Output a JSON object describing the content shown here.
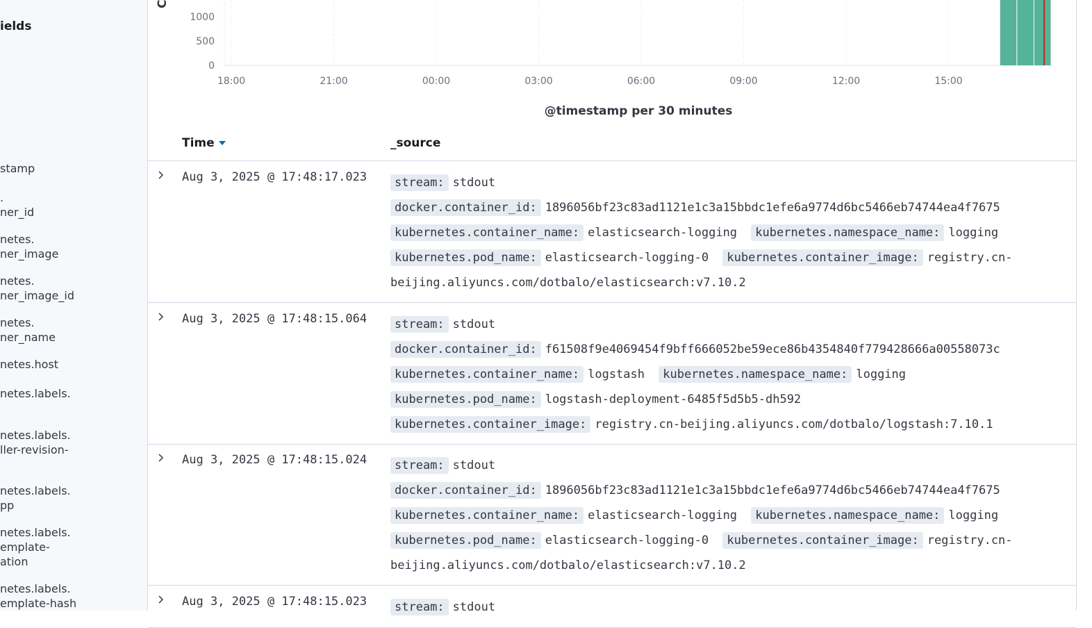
{
  "sidebar": {
    "top_fragment": "-",
    "section_title": "ields",
    "fields": [
      {
        "label": "stamp",
        "top": 232
      },
      {
        "label": ".\nner_id",
        "top": 274
      },
      {
        "label": "netes.\nner_image",
        "top": 334
      },
      {
        "label": "netes.\nner_image_id",
        "top": 394
      },
      {
        "label": "netes.\nner_name",
        "top": 454
      },
      {
        "label": "netes.host",
        "top": 514
      },
      {
        "label": "netes.labels.",
        "top": 556
      },
      {
        "label": "netes.labels.\nller-revision-",
        "top": 616
      },
      {
        "label": "netes.labels.\npp",
        "top": 696
      },
      {
        "label": "netes.labels.\nemplate-\nation",
        "top": 756
      },
      {
        "label": "netes.labels.\nemplate-hash",
        "top": 837
      }
    ]
  },
  "chart_data": {
    "type": "bar",
    "title": "",
    "xlabel": "@timestamp per 30 minutes",
    "ylabel": "Co",
    "y_ticks": [
      0,
      500,
      1000
    ],
    "x_ticks": [
      "18:00",
      "21:00",
      "00:00",
      "03:00",
      "06:00",
      "09:00",
      "12:00",
      "15:00"
    ],
    "bar_color": "#54b399",
    "marker_color": "#bd271e",
    "bars": [
      {
        "x": "16:30",
        "value": 1400
      },
      {
        "x": "17:00",
        "value": 1400
      },
      {
        "x": "17:30",
        "value": 1400
      }
    ],
    "now_marker": "17:48"
  },
  "table": {
    "time_header": "Time",
    "source_header": "_source",
    "rows": [
      {
        "time": "Aug 3, 2025 @ 17:48:17.023",
        "fields": [
          {
            "k": "stream:",
            "v": "stdout"
          },
          {
            "k": "docker.container_id:",
            "v": "1896056bf23c83ad1121e1c3a15bbdc1efe6a9774d6bc5466eb74744ea4f7675"
          },
          {
            "k": "kubernetes.container_name:",
            "v": "elasticsearch-logging"
          },
          {
            "k": "kubernetes.namespace_name:",
            "v": "logging"
          },
          {
            "k": "kubernetes.pod_name:",
            "v": "elasticsearch-logging-0"
          },
          {
            "k": "kubernetes.container_image:",
            "v": "registry.cn-beijing.aliyuncs.com/dotbalo/elasticsearch:v7.10.2"
          }
        ]
      },
      {
        "time": "Aug 3, 2025 @ 17:48:15.064",
        "fields": [
          {
            "k": "stream:",
            "v": "stdout"
          },
          {
            "k": "docker.container_id:",
            "v": "f61508f9e4069454f9bff666052be59ece86b4354840f779428666a00558073c"
          },
          {
            "k": "kubernetes.container_name:",
            "v": "logstash"
          },
          {
            "k": "kubernetes.namespace_name:",
            "v": "logging"
          },
          {
            "k": "kubernetes.pod_name:",
            "v": "logstash-deployment-6485f5d5b5-dh592"
          },
          {
            "k": "kubernetes.container_image:",
            "v": "registry.cn-beijing.aliyuncs.com/dotbalo/logstash:7.10.1"
          }
        ]
      },
      {
        "time": "Aug 3, 2025 @ 17:48:15.024",
        "fields": [
          {
            "k": "stream:",
            "v": "stdout"
          },
          {
            "k": "docker.container_id:",
            "v": "1896056bf23c83ad1121e1c3a15bbdc1efe6a9774d6bc5466eb74744ea4f7675"
          },
          {
            "k": "kubernetes.container_name:",
            "v": "elasticsearch-logging"
          },
          {
            "k": "kubernetes.namespace_name:",
            "v": "logging"
          },
          {
            "k": "kubernetes.pod_name:",
            "v": "elasticsearch-logging-0"
          },
          {
            "k": "kubernetes.container_image:",
            "v": "registry.cn-beijing.aliyuncs.com/dotbalo/elasticsearch:v7.10.2"
          }
        ]
      },
      {
        "time": "Aug 3, 2025 @ 17:48:15.023",
        "fields": [
          {
            "k": "stream:",
            "v": "stdout"
          }
        ]
      }
    ]
  }
}
